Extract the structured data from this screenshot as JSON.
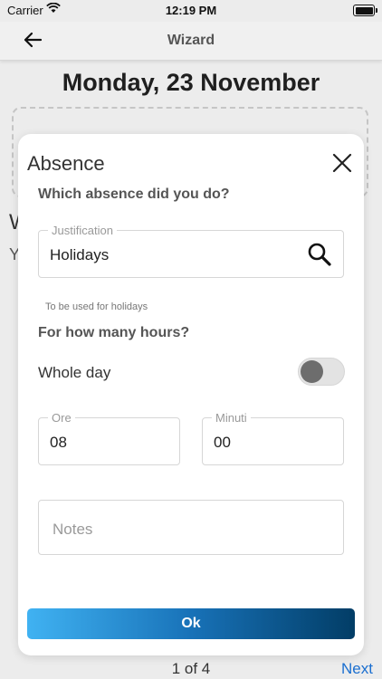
{
  "status_bar": {
    "carrier": "Carrier",
    "time": "12:19 PM"
  },
  "nav": {
    "title": "Wizard"
  },
  "page": {
    "date_title": "Monday, 23 November",
    "bg_letter_w": "W",
    "bg_letter_y": "Y",
    "pager": "1 of 4",
    "next": "Next"
  },
  "modal": {
    "title": "Absence",
    "question_absence": "Which absence did you do?",
    "justification_label": "Justification",
    "justification_value": "Holidays",
    "hint": "To be used for holidays",
    "question_hours": "For how many hours?",
    "whole_day_label": "Whole day",
    "whole_day_on": false,
    "ore_label": "Ore",
    "ore_value": "08",
    "minuti_label": "Minuti",
    "minuti_value": "00",
    "notes_placeholder": "Notes",
    "ok_label": "Ok"
  },
  "icons": {
    "back": "arrow-left-icon",
    "close": "close-icon",
    "search": "search-icon",
    "wifi": "wifi-icon",
    "battery": "battery-icon"
  },
  "colors": {
    "accent_link": "#1b6fd0",
    "button_gradient_start": "#40b2f2",
    "button_gradient_end": "#023d66"
  }
}
